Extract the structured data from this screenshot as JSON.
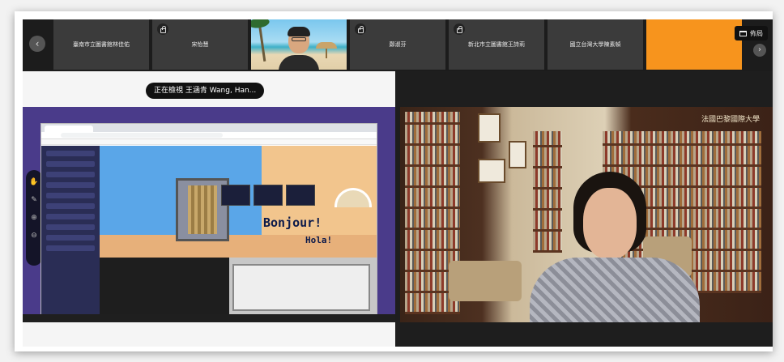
{
  "strip": {
    "tiles": [
      {
        "label": "臺南市立圖書館林佳佑",
        "locked": false
      },
      {
        "label": "宋怡慧",
        "locked": true
      },
      {
        "label": "",
        "locked": false,
        "video": true
      },
      {
        "label": "鄭淑芬",
        "locked": true
      },
      {
        "label": "新北市立圖書館王詩莉",
        "locked": true
      },
      {
        "label": "國立台灣大學陳素幀",
        "locked": false
      },
      {
        "label": "",
        "locked": false,
        "color": "#f7941d"
      }
    ],
    "prev_icon": "‹",
    "next_icon": "›",
    "layout_label": "佈局"
  },
  "share": {
    "viewing_label": "正在檢視 王涵青 Wang, Han...",
    "bonjour": "Bonjour!",
    "hola": "Hola!"
  },
  "camera": {
    "sign_text": "法國巴黎國際大學"
  },
  "colors": {
    "accent_orange": "#f7941d",
    "strip_bg": "#1c1c1c",
    "tile_bg": "#3b3b3b"
  }
}
